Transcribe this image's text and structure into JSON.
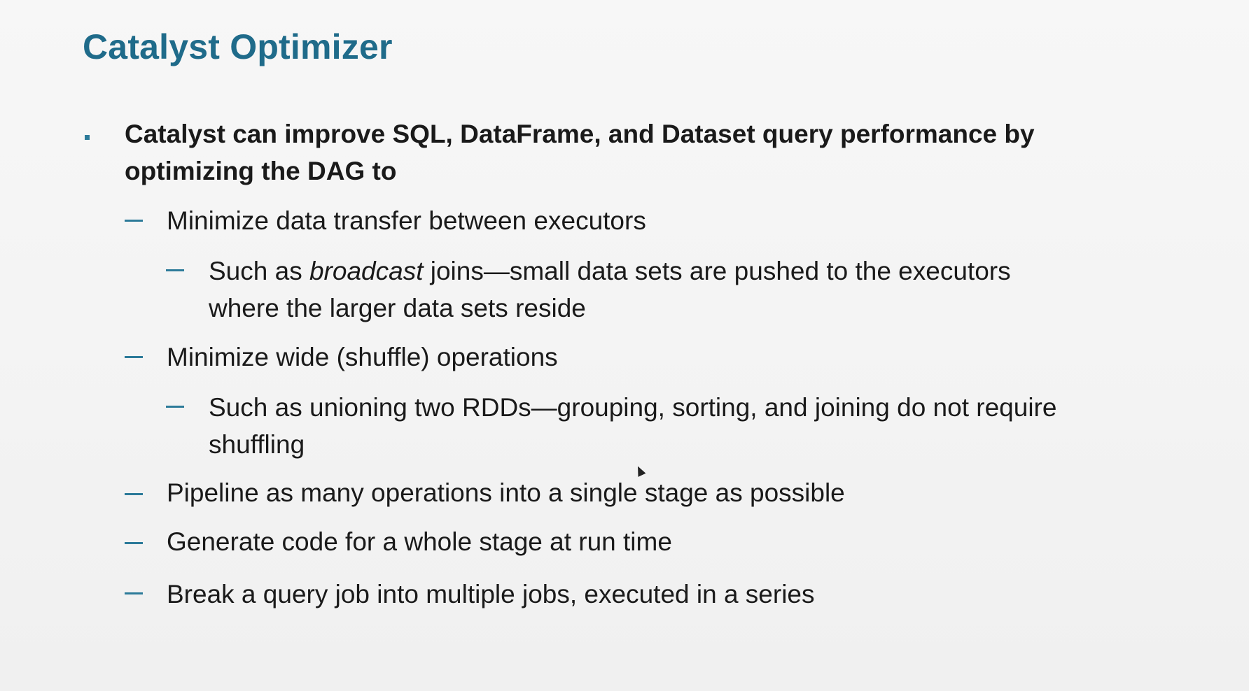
{
  "slide": {
    "title": "Catalyst Optimizer",
    "main_bullet": {
      "line1": "Catalyst can improve SQL, DataFrame, and Dataset query performance by",
      "line2": "optimizing the DAG to"
    },
    "items": [
      {
        "text": "Minimize data transfer between executors"
      },
      {
        "prefix": "Such as ",
        "emphasis": "broadcast",
        "suffix": " joins—small data sets are pushed to the executors",
        "line2": "where the larger data sets reside"
      },
      {
        "text": "Minimize wide (shuffle) operations"
      },
      {
        "line1": "Such as unioning two RDDs—grouping, sorting, and joining do not require",
        "line2": "shuffling"
      },
      {
        "text": "Pipeline as many operations into a single stage as possible"
      },
      {
        "text": "Generate code for a whole stage at run time"
      },
      {
        "text": "Break a query job into multiple jobs, executed in a series"
      }
    ],
    "accent_color": "#1f6b8a",
    "bullet_color": "#2c7a99"
  }
}
